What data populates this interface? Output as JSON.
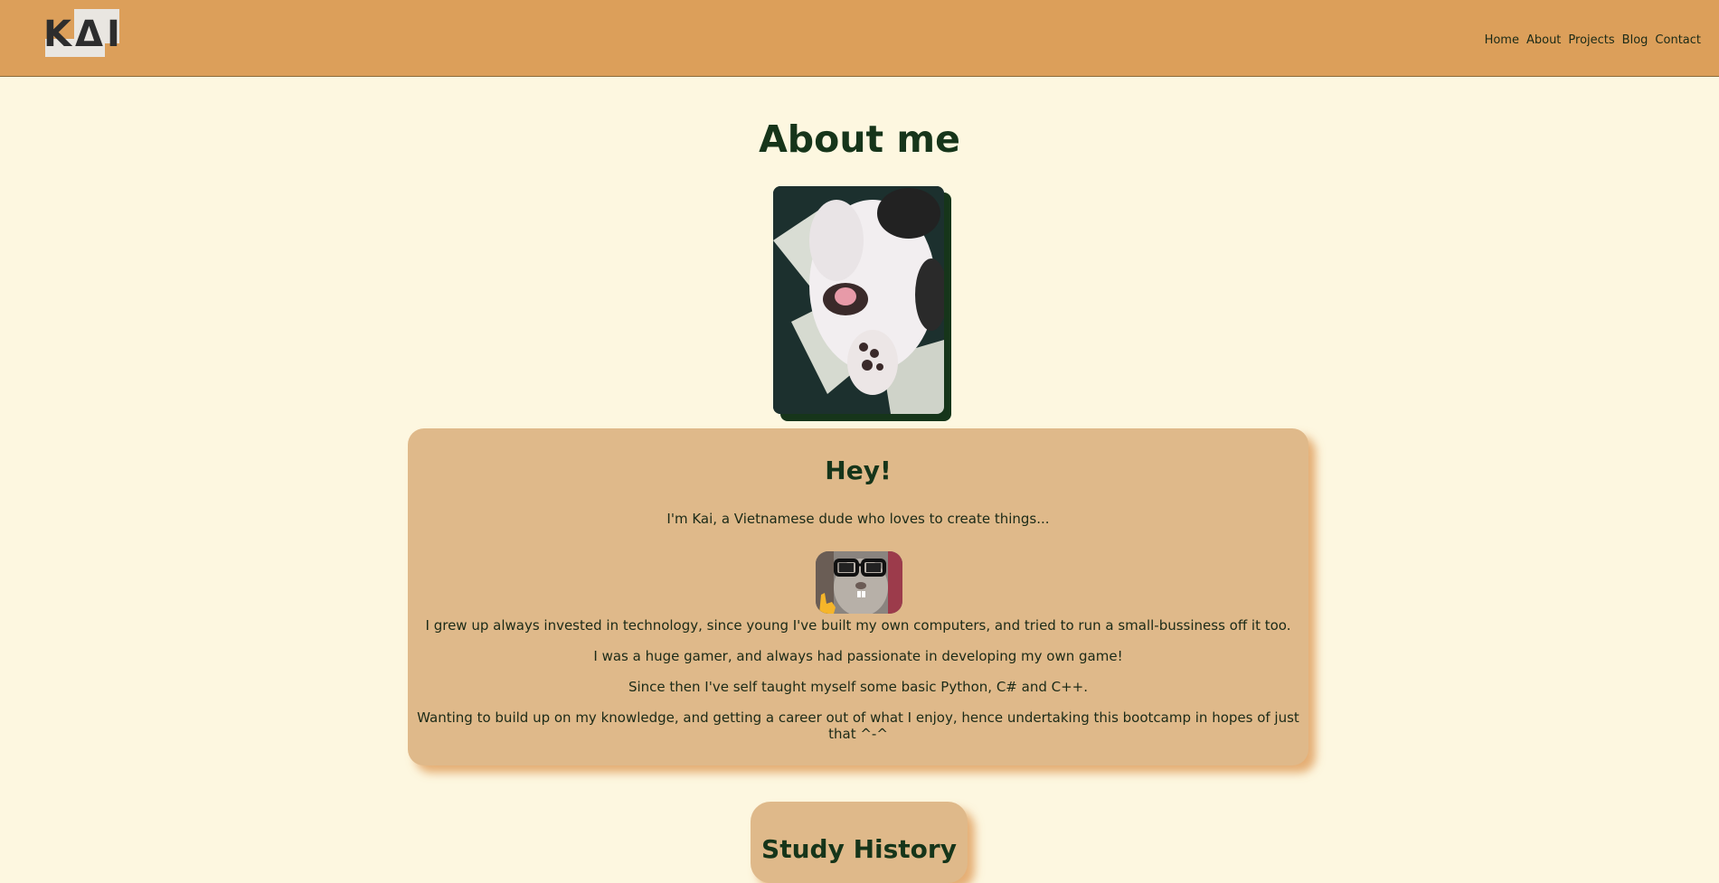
{
  "header": {
    "logo_text": "KΔI",
    "nav": [
      "Home",
      "About",
      "Projects",
      "Blog",
      "Contact"
    ]
  },
  "main": {
    "title": "About me",
    "card": {
      "title": "Hey!",
      "intro": "I'm Kai, a Vietnamese dude who loves to create things...",
      "paragraphs": [
        "I grew up always invested in technology, since young I've built my own computers, and tried to run a small-bussiness off it too.",
        "I was a huge gamer, and always had passionate in developing my own game!",
        "Since then I've self taught myself some basic Python, C# and C++.",
        "Wanting to build up on my knowledge, and getting a career out of what I enjoy, hence undertaking this bootcamp in hopes of just that ^-^"
      ]
    },
    "study": {
      "title": "Study History"
    }
  },
  "colors": {
    "header_bg": "#dc9f5a",
    "page_bg": "#fdf7e0",
    "card_bg": "#dfb98a",
    "heading": "#16351a"
  }
}
